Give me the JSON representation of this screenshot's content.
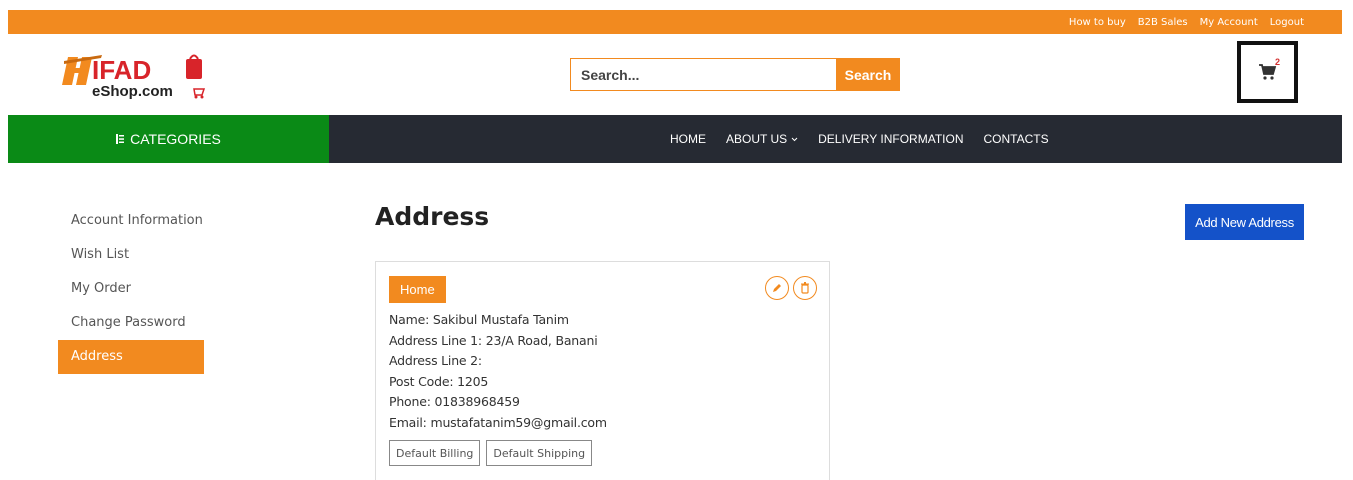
{
  "topbar": {
    "links": [
      "How to buy",
      "B2B Sales",
      "My Account",
      "Logout"
    ]
  },
  "logo": {
    "brand": "IFAD",
    "sub": "eShop.com"
  },
  "search": {
    "placeholder": "Search...",
    "button": "Search"
  },
  "cart": {
    "count": "2",
    "icon": "cart-icon"
  },
  "nav": {
    "categories_label": "CATEGORIES",
    "menu": [
      "HOME",
      "ABOUT US",
      "DELIVERY INFORMATION",
      "CONTACTS"
    ]
  },
  "sidebar": {
    "items": [
      {
        "label": "Account Information"
      },
      {
        "label": "Wish List"
      },
      {
        "label": "My Order"
      },
      {
        "label": "Change Password"
      },
      {
        "label": "Address"
      }
    ]
  },
  "main": {
    "title": "Address",
    "add_button": "Add New Address",
    "card": {
      "tag": "Home",
      "lines": [
        "Name: Sakibul Mustafa Tanim",
        "Address Line 1: 23/A Road, Banani",
        "Address Line 2:",
        "Post Code: 1205",
        "Phone: 01838968459",
        "Email: mustafatanim59@gmail.com"
      ],
      "default_billing": "Default Billing",
      "default_shipping": "Default Shipping"
    }
  },
  "colors": {
    "accent": "#f28a1f",
    "categories_bg": "#0a8a16",
    "nav_bg": "#262a33",
    "primary_button": "#1452c9"
  }
}
